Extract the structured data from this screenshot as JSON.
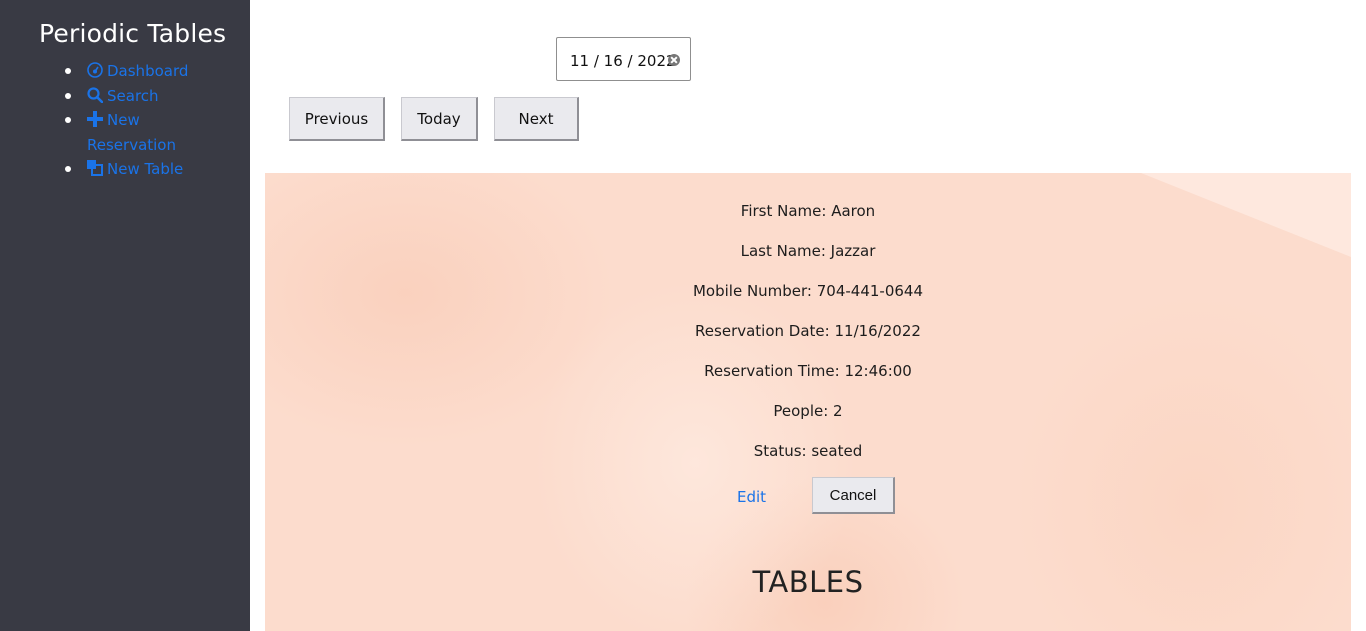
{
  "sidebar": {
    "title": "Periodic Tables",
    "items": [
      {
        "label": "Dashboard",
        "icon": "dashboard-icon"
      },
      {
        "label": "Search",
        "icon": "search-icon"
      },
      {
        "label": "New Reservation",
        "label_line1": "New",
        "label_line2": "Reservation",
        "icon": "plus-icon"
      },
      {
        "label": "New Table",
        "icon": "layers-icon"
      }
    ]
  },
  "date_picker": {
    "value": "11 / 16 / 2022"
  },
  "navigation": {
    "previous": "Previous",
    "today": "Today",
    "next": "Next"
  },
  "reservation": {
    "first_name": "First Name: Aaron",
    "last_name": "Last Name: Jazzar",
    "mobile": "Mobile Number: 704-441-0644",
    "date": "Reservation Date: 11/16/2022",
    "time": "Reservation Time: 12:46:00",
    "people": "People: 2",
    "status": "Status: seated",
    "edit_label": "Edit",
    "cancel_label": "Cancel"
  },
  "tables_heading": "TABLES",
  "colors": {
    "sidebar_bg": "#393a44",
    "link": "#1a73e8",
    "panel_bg": "#fcdccd"
  }
}
